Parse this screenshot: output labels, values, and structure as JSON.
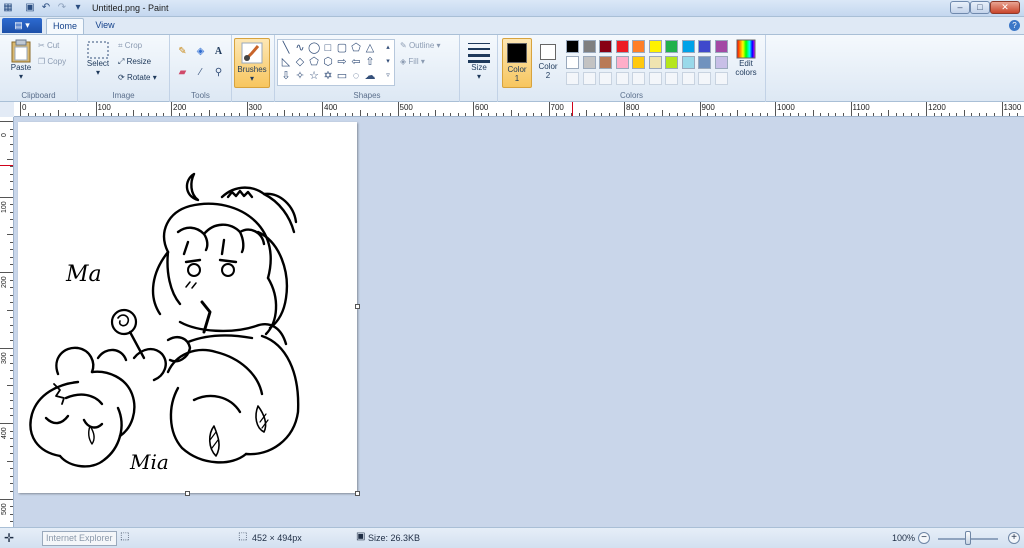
{
  "window": {
    "title": "Untitled.png - Paint",
    "controls": {
      "minimize": "–",
      "maximize": "□",
      "close": "✕"
    }
  },
  "tabs": {
    "file": "▤ ▾",
    "home": "Home",
    "view": "View",
    "help": "?"
  },
  "ribbon": {
    "clipboard": {
      "paste": "Paste",
      "cut": "Cut",
      "copy": "Copy",
      "label": "Clipboard"
    },
    "image": {
      "select": "Select",
      "crop": "Crop",
      "resize": "Resize",
      "rotate": "Rotate",
      "label": "Image"
    },
    "tools": {
      "label": "Tools",
      "text_tool": "A"
    },
    "brushes": {
      "label": "Brushes"
    },
    "shapes": {
      "outline": "Outline",
      "fill": "Fill",
      "label": "Shapes"
    },
    "size": {
      "label": "Size"
    },
    "colors": {
      "color1_label": "Color",
      "color1_num": "1",
      "color2_label": "Color",
      "color2_num": "2",
      "edit_label": "Edit",
      "edit_label2": "colors",
      "label": "Colors",
      "color1": "#000000",
      "color2": "#ffffff",
      "palette_row1": [
        "#000000",
        "#7f7f7f",
        "#880015",
        "#ed1c24",
        "#ff7f27",
        "#fff200",
        "#22b14c",
        "#00a2e8",
        "#3f48cc",
        "#a349a4"
      ],
      "palette_row2": [
        "#ffffff",
        "#c3c3c3",
        "#b97a57",
        "#ffaec9",
        "#ffc90e",
        "#efe4b0",
        "#b5e61d",
        "#99d9ea",
        "#7092be",
        "#c8bfe7"
      ]
    }
  },
  "ruler": {
    "horizontal": [
      "0",
      "100",
      "200",
      "300",
      "400",
      "500",
      "600",
      "700",
      "800",
      "900",
      "1000",
      "1100",
      "1200",
      "1300"
    ],
    "vertical": [
      "0",
      "100",
      "200",
      "300",
      "400",
      "500"
    ]
  },
  "canvas": {
    "sketch_text_top": "Ma",
    "sketch_text_bottom": "Mia"
  },
  "status": {
    "tooltip": "Internet Explorer",
    "image_size": "452 × 494px",
    "file_size": "Size: 26.3KB",
    "zoom": "100%"
  }
}
